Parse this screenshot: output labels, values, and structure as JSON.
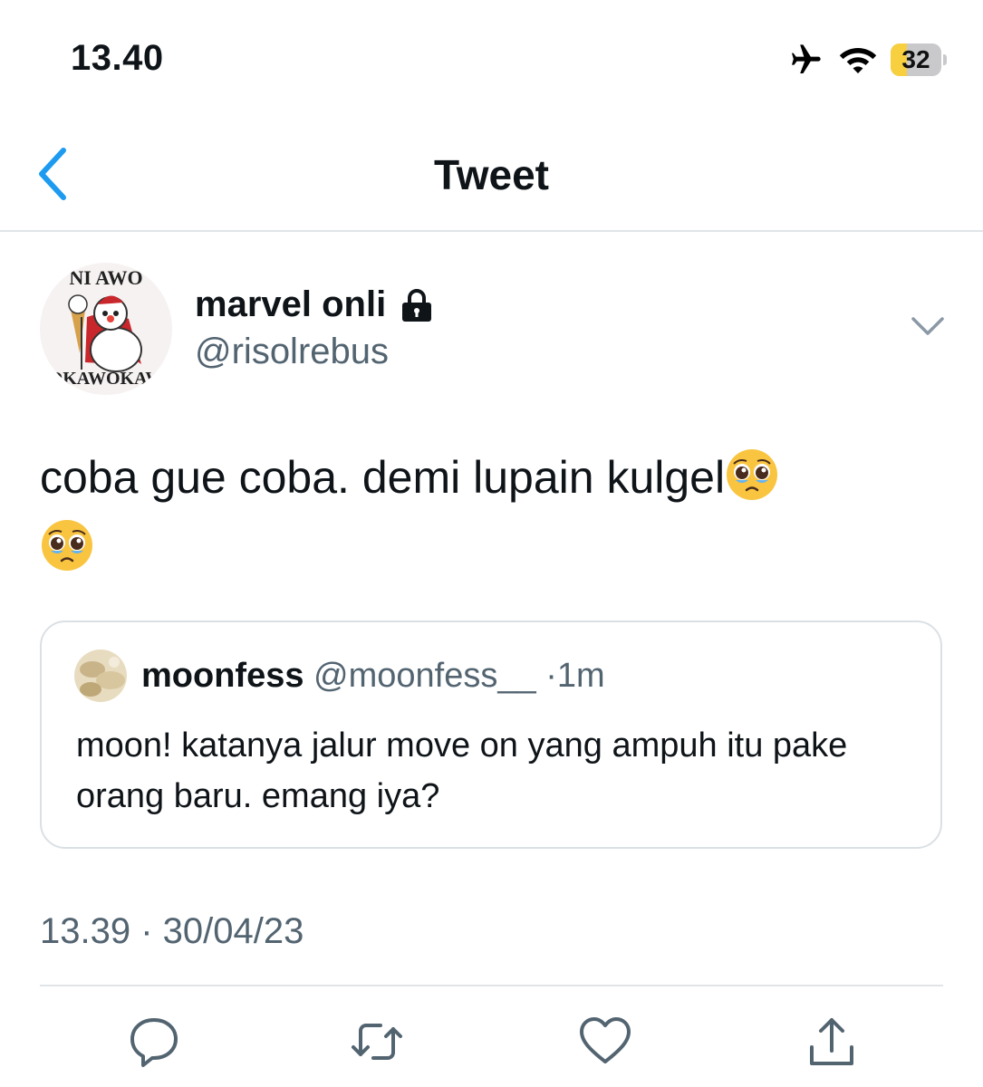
{
  "status_bar": {
    "time": "13.40",
    "icons": [
      "airplane-icon",
      "wifi-icon",
      "battery-icon"
    ],
    "battery_level": "32",
    "battery_fraction": 0.32
  },
  "nav": {
    "back_icon": "chevron-left-icon",
    "title": "Tweet"
  },
  "tweet": {
    "author": {
      "name": "marvel onli",
      "protected_icon": "lock-icon",
      "handle": "@risolrebus",
      "avatar_text_top": "NI AWO",
      "avatar_text_bottom": "OKAWOKAW"
    },
    "menu_icon": "chevron-down-icon",
    "text": "coba gue coba. demi lupain kulgel",
    "emojis": [
      "pleading-face-emoji",
      "pleading-face-emoji"
    ],
    "quoted": {
      "name": "moonfess",
      "handle": "@moonfess__",
      "separator": "·",
      "time": "1m",
      "text": "moon! katanya jalur move on yang ampuh itu pake orang baru. emang iya?"
    },
    "timestamp": "13.39 · 30/04/23",
    "actions": [
      "reply-icon",
      "retweet-icon",
      "like-icon",
      "share-icon"
    ]
  },
  "colors": {
    "accent": "#1d9bf0",
    "text": "#0f1419",
    "secondary_text": "#536471",
    "divider": "#e1e4e7",
    "battery_fill": "#f7cf3f"
  }
}
